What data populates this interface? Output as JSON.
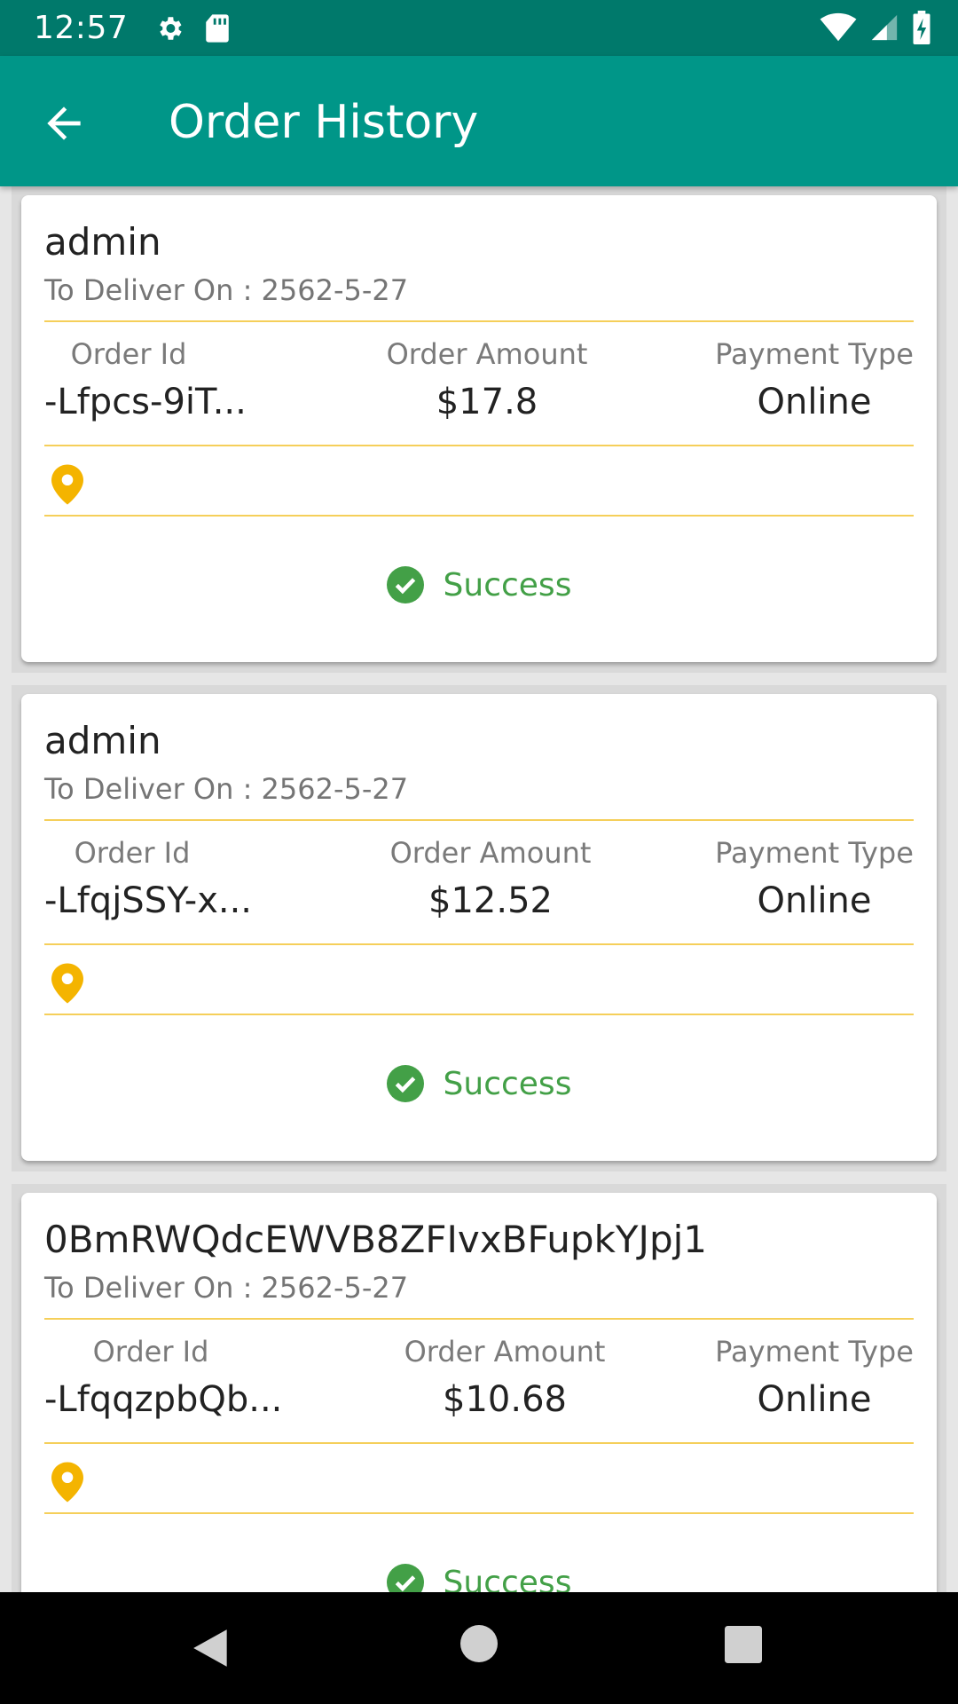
{
  "status_bar": {
    "time": "12:57",
    "icons": [
      "gear-icon",
      "sd-card-icon",
      "wifi-icon",
      "signal-icon",
      "battery-charging-icon"
    ]
  },
  "app_bar": {
    "title": "Order History",
    "back_icon": "arrow-back-icon"
  },
  "colors": {
    "status_bar": "#00796b",
    "app_bar": "#009688",
    "separator": "#f5cf5a",
    "pin": "#f4b400",
    "success": "#43a047"
  },
  "orders": [
    {
      "name": "admin",
      "deliver_label": "To Deliver On : 2562-5-27",
      "order_id_label": "Order Id",
      "order_id": "-Lfpcs-9iT...",
      "amount_label": "Order Amount",
      "amount": "$17.8",
      "payment_label": "Payment Type",
      "payment": "Online",
      "status": "Success"
    },
    {
      "name": "admin",
      "deliver_label": "To Deliver On : 2562-5-27",
      "order_id_label": "Order Id",
      "order_id": "-LfqjSSY-x...",
      "amount_label": "Order Amount",
      "amount": "$12.52",
      "payment_label": "Payment Type",
      "payment": "Online",
      "status": "Success"
    },
    {
      "name": "0BmRWQdcEWVB8ZFIvxBFupkYJpj1",
      "deliver_label": "To Deliver On : 2562-5-27",
      "order_id_label": "Order Id",
      "order_id": "-LfqqzpbQb...",
      "amount_label": "Order Amount",
      "amount": "$10.68",
      "payment_label": "Payment Type",
      "payment": "Online",
      "status": "Success"
    }
  ],
  "nav_bar": {
    "buttons": [
      "back-triangle-icon",
      "home-circle-icon",
      "recents-square-icon"
    ]
  }
}
